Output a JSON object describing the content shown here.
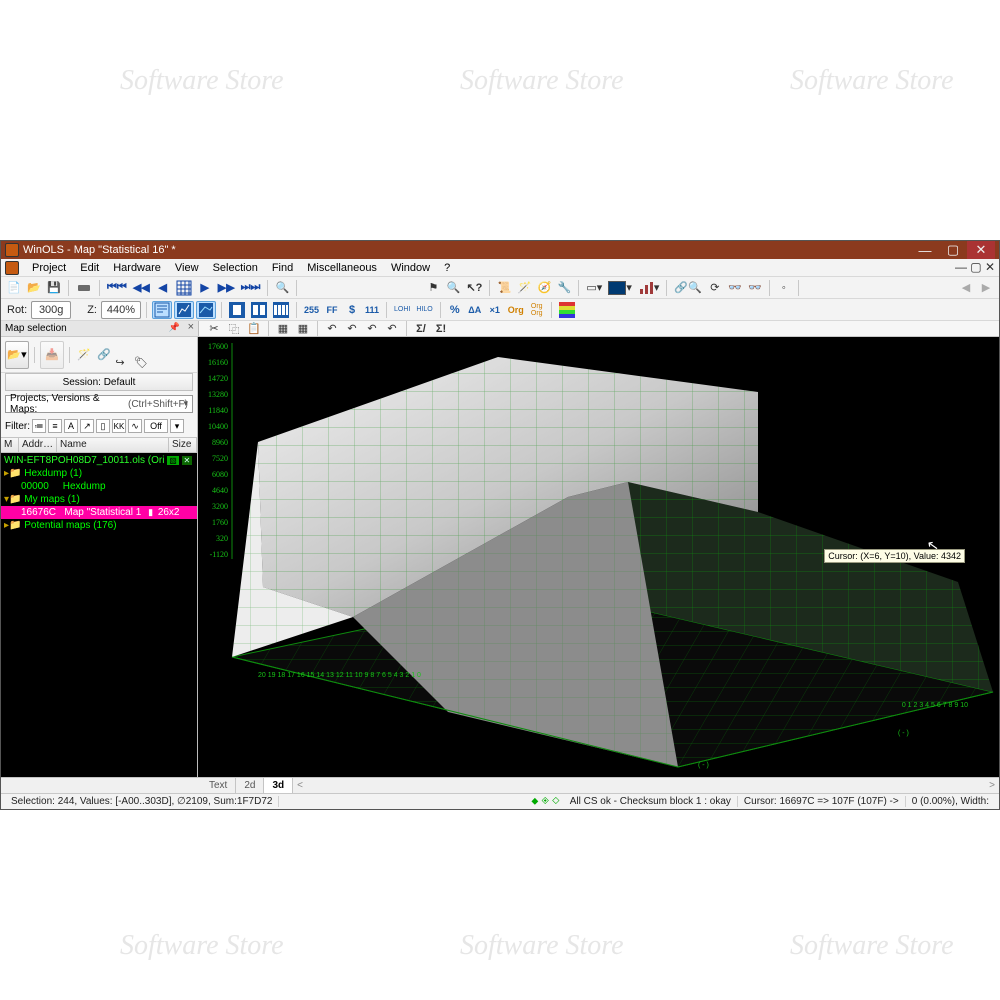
{
  "title": "WinOLS - Map \"Statistical 16\" *",
  "menu": [
    "Project",
    "Edit",
    "Hardware",
    "View",
    "Selection",
    "Find",
    "Miscellaneous",
    "Window",
    "?"
  ],
  "toolbar1": {
    "rot_label": "Rot:",
    "rot_value": "300g",
    "z_label": "Z:",
    "z_value": "440%"
  },
  "toolbar_text": {
    "ff": "FF",
    "n255": "255",
    "dollar": "$",
    "one11": "111",
    "hilo": "HILO",
    "lohi": "LOHI",
    "pct": "%",
    "dA": "ΔA",
    "x1": "×1",
    "org": "Org",
    "orgorg": "Org\nOrg"
  },
  "doc_toolstrip": {
    "sigma1": "Σ/",
    "sigma2": "Σ!"
  },
  "sidebar": {
    "panel_title": "Map selection",
    "session_label": "Session: Default",
    "combo_label": "Projects, Versions & Maps:",
    "combo_hotkey": "(Ctrl+Shift+F)",
    "filter_label": "Filter:",
    "filter_off": "Off",
    "columns": {
      "m": "M",
      "addr": "Addr…",
      "name": "Name",
      "size": "Size"
    },
    "tree": {
      "root": "WIN-EFT8POH08D7_10011.ols (Ori",
      "hexdump_group": "Hexdump (1)",
      "hexdump_addr": "00000",
      "hexdump_name": "Hexdump",
      "mymaps_group": "My maps (1)",
      "map_addr": "16676C",
      "map_name": "Map \"Statistical 1",
      "map_size": "26x2",
      "potential": "Potential maps (176)"
    }
  },
  "viewport": {
    "z_ticks": [
      "17600",
      "16160",
      "14720",
      "13280",
      "11840",
      "10400",
      "8960",
      "7520",
      "6080",
      "4640",
      "3200",
      "1760",
      "320",
      "-1120"
    ],
    "tooltip": "Cursor: (X=6, Y=10), Value: 4342"
  },
  "view_tabs": {
    "text": "Text",
    "d2": "2d",
    "d3": "3d"
  },
  "status": {
    "left": "Selection: 244, Values: [-A00..303D], ∅2109, Sum:1F7D72",
    "checksum": "All CS ok - Checksum block 1 : okay",
    "cursor": "Cursor: 16697C => 107F (107F) ->",
    "delta": "0 (0.00%), Width:"
  },
  "watermark": "Software Store"
}
